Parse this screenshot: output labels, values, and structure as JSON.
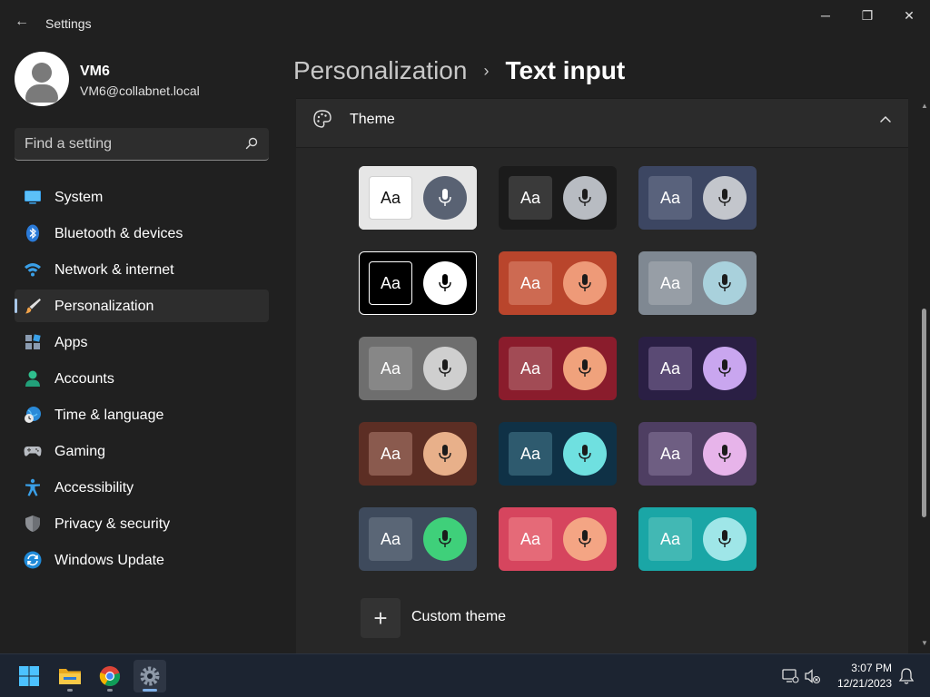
{
  "window": {
    "title": "Settings",
    "minimize": "─",
    "maximize": "❐",
    "close": "✕",
    "back": "←"
  },
  "profile": {
    "name": "VM6",
    "email": "VM6@collabnet.local"
  },
  "search": {
    "placeholder": "Find a setting"
  },
  "sidebar": {
    "items": [
      {
        "label": "System",
        "icon": "system-icon"
      },
      {
        "label": "Bluetooth & devices",
        "icon": "bluetooth-icon"
      },
      {
        "label": "Network & internet",
        "icon": "wifi-icon"
      },
      {
        "label": "Personalization",
        "icon": "brush-icon",
        "active": true
      },
      {
        "label": "Apps",
        "icon": "apps-icon"
      },
      {
        "label": "Accounts",
        "icon": "accounts-icon"
      },
      {
        "label": "Time & language",
        "icon": "globe-clock-icon"
      },
      {
        "label": "Gaming",
        "icon": "gamepad-icon"
      },
      {
        "label": "Accessibility",
        "icon": "accessibility-icon"
      },
      {
        "label": "Privacy & security",
        "icon": "shield-icon"
      },
      {
        "label": "Windows Update",
        "icon": "update-icon"
      }
    ]
  },
  "breadcrumb": {
    "parent": "Personalization",
    "separator": "›",
    "current": "Text input"
  },
  "theme_section": {
    "title": "Theme",
    "sample_text": "Aa",
    "tiles": [
      {
        "bg": "#e6e6e6",
        "sq": "#ffffff",
        "text": "#111111",
        "mic": "#596273",
        "micIcon": "#ffffff",
        "border": "#e6e6e6"
      },
      {
        "bg": "#1b1b1b",
        "sq": "#3a3a3a",
        "text": "#ffffff",
        "mic": "#b8bcc2",
        "micIcon": "#1b1b1b"
      },
      {
        "bg": "#3c4662",
        "sq": "#59627c",
        "text": "#ffffff",
        "mic": "#c3c6cc",
        "micIcon": "#1b1b1b"
      },
      {
        "bg": "#000000",
        "sq": "#000000",
        "text": "#ffffff",
        "mic": "#ffffff",
        "micIcon": "#000000",
        "border": "#ffffff"
      },
      {
        "bg": "#b9452c",
        "sq": "#cd6a52",
        "text": "#ffffff",
        "mic": "#ee9a78",
        "micIcon": "#1b1b1b"
      },
      {
        "bg": "#7f8892",
        "sq": "#979ea6",
        "text": "#ffffff",
        "mic": "#a9d1dc",
        "micIcon": "#1b1b1b"
      },
      {
        "bg": "#6e6e6e",
        "sq": "#878787",
        "text": "#ffffff",
        "mic": "#cfcfcf",
        "micIcon": "#1b1b1b"
      },
      {
        "bg": "#8a1c2c",
        "sq": "#a24b55",
        "text": "#ffffff",
        "mic": "#f0a27c",
        "micIcon": "#1b1b1b"
      },
      {
        "bg": "#2a1f44",
        "sq": "#5a4a74",
        "text": "#ffffff",
        "mic": "#c9a6ef",
        "micIcon": "#1b1b1b"
      },
      {
        "bg": "#5c2e24",
        "sq": "#8a5a4e",
        "text": "#ffffff",
        "mic": "#e8b08a",
        "micIcon": "#1b1b1b"
      },
      {
        "bg": "#0f3146",
        "sq": "#2e5a6e",
        "text": "#ffffff",
        "mic": "#6fe0e0",
        "micIcon": "#1b1b1b"
      },
      {
        "bg": "#4e3e62",
        "sq": "#6e5e82",
        "text": "#ffffff",
        "mic": "#e7b4ea",
        "micIcon": "#1b1b1b"
      },
      {
        "bg": "#3e4a5c",
        "sq": "#5a6676",
        "text": "#ffffff",
        "mic": "#3fd07a",
        "micIcon": "#1b1b1b"
      },
      {
        "bg": "#d6455e",
        "sq": "#e56a78",
        "text": "#ffffff",
        "mic": "#f4a584",
        "micIcon": "#1b1b1b"
      },
      {
        "bg": "#1aa6a6",
        "sq": "#42b8b4",
        "text": "#ffffff",
        "mic": "#9fe6e8",
        "micIcon": "#1b1b1b"
      }
    ],
    "custom_label": "Custom theme",
    "custom_plus": "+"
  },
  "taskbar": {
    "apps": [
      "start-icon",
      "file-explorer-icon",
      "chrome-icon",
      "settings-app-icon"
    ],
    "time": "3:07 PM",
    "date": "12/21/2023"
  },
  "colors": {
    "background": "#202020",
    "panel": "#272727",
    "accent": "#a8c7e8",
    "taskbar": "#1c2431"
  }
}
